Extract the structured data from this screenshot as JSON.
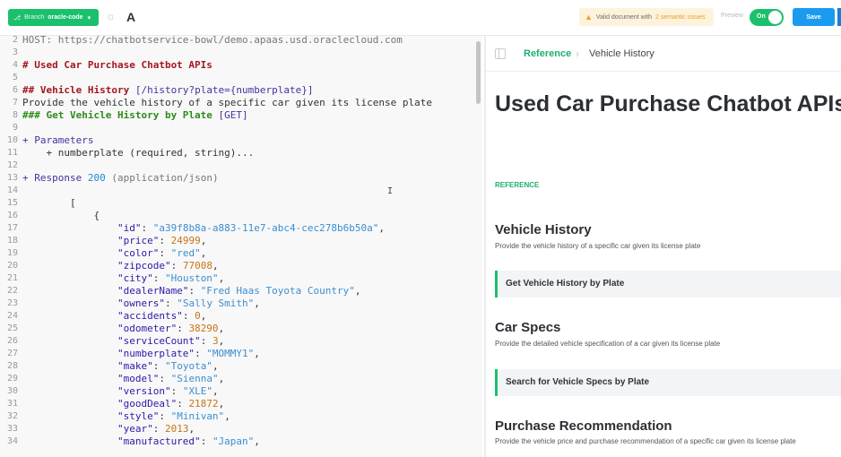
{
  "toolbar": {
    "branch_label": "Branch",
    "branch_name": "oracle-code",
    "theme_icon": "sun-icon",
    "font_icon": "A",
    "validation": {
      "text": "Valid document with",
      "issues": "2 semantic issues",
      "icon": "warning-icon"
    },
    "preview_label": "Preview",
    "toggle_label": "On",
    "save_label": "Save"
  },
  "editor": {
    "lines": [
      {
        "n": "2",
        "parts": [
          {
            "t": "HOST: https://chatbotservice-bowl/demo.apaas.usd.oraclecloud.com",
            "c": "tk-gray"
          }
        ]
      },
      {
        "n": "3",
        "parts": []
      },
      {
        "n": "4",
        "parts": [
          {
            "t": "# Used Car Purchase Chatbot APIs",
            "c": "tk-h"
          }
        ]
      },
      {
        "n": "5",
        "parts": []
      },
      {
        "n": "6",
        "parts": [
          {
            "t": "## Vehicle History ",
            "c": "tk-h"
          },
          {
            "t": "[/history?plate={numberplate}]",
            "c": "tk-link"
          }
        ]
      },
      {
        "n": "7",
        "parts": [
          {
            "t": "Provide the vehicle history of a specific car given its license plate",
            "c": "tk-plain"
          }
        ]
      },
      {
        "n": "8",
        "parts": [
          {
            "t": "### Get Vehicle History by Plate ",
            "c": "tk-green"
          },
          {
            "t": "[GET]",
            "c": "tk-link"
          }
        ]
      },
      {
        "n": "9",
        "parts": []
      },
      {
        "n": "10",
        "parts": [
          {
            "t": "+ Parameters",
            "c": "tk-purple"
          }
        ]
      },
      {
        "n": "11",
        "parts": [
          {
            "t": "    + numberplate (required, string)...",
            "c": "tk-plain"
          }
        ]
      },
      {
        "n": "12",
        "parts": []
      },
      {
        "n": "13",
        "parts": [
          {
            "t": "+ Response ",
            "c": "tk-purple"
          },
          {
            "t": "200",
            "c": "tk-num"
          },
          {
            "t": " (application/json)",
            "c": "tk-gray"
          }
        ]
      },
      {
        "n": "14",
        "parts": []
      },
      {
        "n": "15",
        "parts": [
          {
            "t": "        [",
            "c": "tk-plain"
          }
        ]
      },
      {
        "n": "16",
        "parts": [
          {
            "t": "            {",
            "c": "tk-plain"
          }
        ]
      },
      {
        "n": "17",
        "parts": [
          {
            "t": "                \"id\"",
            "c": "tk-key"
          },
          {
            "t": ": ",
            "c": "tk-plain"
          },
          {
            "t": "\"a39f8b8a-a883-11e7-abc4-cec278b6b50a\"",
            "c": "tk-str"
          },
          {
            "t": ",",
            "c": "tk-plain"
          }
        ]
      },
      {
        "n": "18",
        "parts": [
          {
            "t": "                \"price\"",
            "c": "tk-key"
          },
          {
            "t": ": ",
            "c": "tk-plain"
          },
          {
            "t": "24999",
            "c": "tk-val"
          },
          {
            "t": ",",
            "c": "tk-plain"
          }
        ]
      },
      {
        "n": "19",
        "parts": [
          {
            "t": "                \"color\"",
            "c": "tk-key"
          },
          {
            "t": ": ",
            "c": "tk-plain"
          },
          {
            "t": "\"red\"",
            "c": "tk-str"
          },
          {
            "t": ",",
            "c": "tk-plain"
          }
        ]
      },
      {
        "n": "20",
        "parts": [
          {
            "t": "                \"zipcode\"",
            "c": "tk-key"
          },
          {
            "t": ": ",
            "c": "tk-plain"
          },
          {
            "t": "77008",
            "c": "tk-val"
          },
          {
            "t": ",",
            "c": "tk-plain"
          }
        ]
      },
      {
        "n": "21",
        "parts": [
          {
            "t": "                \"city\"",
            "c": "tk-key"
          },
          {
            "t": ": ",
            "c": "tk-plain"
          },
          {
            "t": "\"Houston\"",
            "c": "tk-str"
          },
          {
            "t": ",",
            "c": "tk-plain"
          }
        ]
      },
      {
        "n": "22",
        "parts": [
          {
            "t": "                \"dealerName\"",
            "c": "tk-key"
          },
          {
            "t": ": ",
            "c": "tk-plain"
          },
          {
            "t": "\"Fred Haas Toyota Country\"",
            "c": "tk-str"
          },
          {
            "t": ",",
            "c": "tk-plain"
          }
        ]
      },
      {
        "n": "23",
        "parts": [
          {
            "t": "                \"owners\"",
            "c": "tk-key"
          },
          {
            "t": ": ",
            "c": "tk-plain"
          },
          {
            "t": "\"Sally Smith\"",
            "c": "tk-str"
          },
          {
            "t": ",",
            "c": "tk-plain"
          }
        ]
      },
      {
        "n": "24",
        "parts": [
          {
            "t": "                \"accidents\"",
            "c": "tk-key"
          },
          {
            "t": ": ",
            "c": "tk-plain"
          },
          {
            "t": "0",
            "c": "tk-val"
          },
          {
            "t": ",",
            "c": "tk-plain"
          }
        ]
      },
      {
        "n": "25",
        "parts": [
          {
            "t": "                \"odometer\"",
            "c": "tk-key"
          },
          {
            "t": ": ",
            "c": "tk-plain"
          },
          {
            "t": "38290",
            "c": "tk-val"
          },
          {
            "t": ",",
            "c": "tk-plain"
          }
        ]
      },
      {
        "n": "26",
        "parts": [
          {
            "t": "                \"serviceCount\"",
            "c": "tk-key"
          },
          {
            "t": ": ",
            "c": "tk-plain"
          },
          {
            "t": "3",
            "c": "tk-val"
          },
          {
            "t": ",",
            "c": "tk-plain"
          }
        ]
      },
      {
        "n": "27",
        "parts": [
          {
            "t": "                \"numberplate\"",
            "c": "tk-key"
          },
          {
            "t": ": ",
            "c": "tk-plain"
          },
          {
            "t": "\"MOMMY1\"",
            "c": "tk-str"
          },
          {
            "t": ",",
            "c": "tk-plain"
          }
        ]
      },
      {
        "n": "28",
        "parts": [
          {
            "t": "                \"make\"",
            "c": "tk-key"
          },
          {
            "t": ": ",
            "c": "tk-plain"
          },
          {
            "t": "\"Toyota\"",
            "c": "tk-str"
          },
          {
            "t": ",",
            "c": "tk-plain"
          }
        ]
      },
      {
        "n": "29",
        "parts": [
          {
            "t": "                \"model\"",
            "c": "tk-key"
          },
          {
            "t": ": ",
            "c": "tk-plain"
          },
          {
            "t": "\"Sienna\"",
            "c": "tk-str"
          },
          {
            "t": ",",
            "c": "tk-plain"
          }
        ]
      },
      {
        "n": "30",
        "parts": [
          {
            "t": "                \"version\"",
            "c": "tk-key"
          },
          {
            "t": ": ",
            "c": "tk-plain"
          },
          {
            "t": "\"XLE\"",
            "c": "tk-str"
          },
          {
            "t": ",",
            "c": "tk-plain"
          }
        ]
      },
      {
        "n": "31",
        "parts": [
          {
            "t": "                \"goodDeal\"",
            "c": "tk-key"
          },
          {
            "t": ": ",
            "c": "tk-plain"
          },
          {
            "t": "21872",
            "c": "tk-val"
          },
          {
            "t": ",",
            "c": "tk-plain"
          }
        ]
      },
      {
        "n": "32",
        "parts": [
          {
            "t": "                \"style\"",
            "c": "tk-key"
          },
          {
            "t": ": ",
            "c": "tk-plain"
          },
          {
            "t": "\"Minivan\"",
            "c": "tk-str"
          },
          {
            "t": ",",
            "c": "tk-plain"
          }
        ]
      },
      {
        "n": "33",
        "parts": [
          {
            "t": "                \"year\"",
            "c": "tk-key"
          },
          {
            "t": ": ",
            "c": "tk-plain"
          },
          {
            "t": "2013",
            "c": "tk-val"
          },
          {
            "t": ",",
            "c": "tk-plain"
          }
        ]
      },
      {
        "n": "34",
        "parts": [
          {
            "t": "                \"manufactured\"",
            "c": "tk-key"
          },
          {
            "t": ": ",
            "c": "tk-plain"
          },
          {
            "t": "\"Japan\"",
            "c": "tk-str"
          },
          {
            "t": ",",
            "c": "tk-plain"
          }
        ]
      }
    ]
  },
  "reference": {
    "breadcrumb_root": "Reference",
    "breadcrumb_current": "Vehicle History",
    "api_title": "Used Car Purchase Chatbot APIs",
    "section_label": "REFERENCE",
    "resources": [
      {
        "title": "Vehicle History",
        "desc": "Provide the vehicle history of a specific car given its license plate",
        "action": "Get Vehicle History by Plate"
      },
      {
        "title": "Car Specs",
        "desc": "Provide the detailed vehicle specification of a car given its license plate",
        "action": "Search for Vehicle Specs by Plate"
      },
      {
        "title": "Purchase Recommendation",
        "desc": "Provide the vehicle price and purchase recommendation of a specific car given its license plate",
        "action": ""
      }
    ]
  },
  "colors": {
    "brand_green": "#1bc06d",
    "save_blue": "#1a9bf0",
    "warning_orange": "#f0a020"
  }
}
